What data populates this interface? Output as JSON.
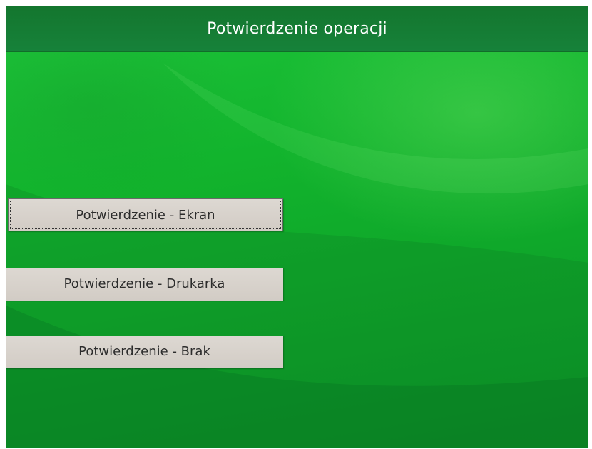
{
  "header": {
    "title": "Potwierdzenie operacji"
  },
  "options": {
    "screen": "Potwierdzenie - Ekran",
    "printer": "Potwierdzenie - Drukarka",
    "none": "Potwierdzenie - Brak"
  },
  "colors": {
    "background": "#14b52e",
    "header": "#16823a",
    "button": "#d8d2cb",
    "button_text": "#2c2c2c"
  }
}
